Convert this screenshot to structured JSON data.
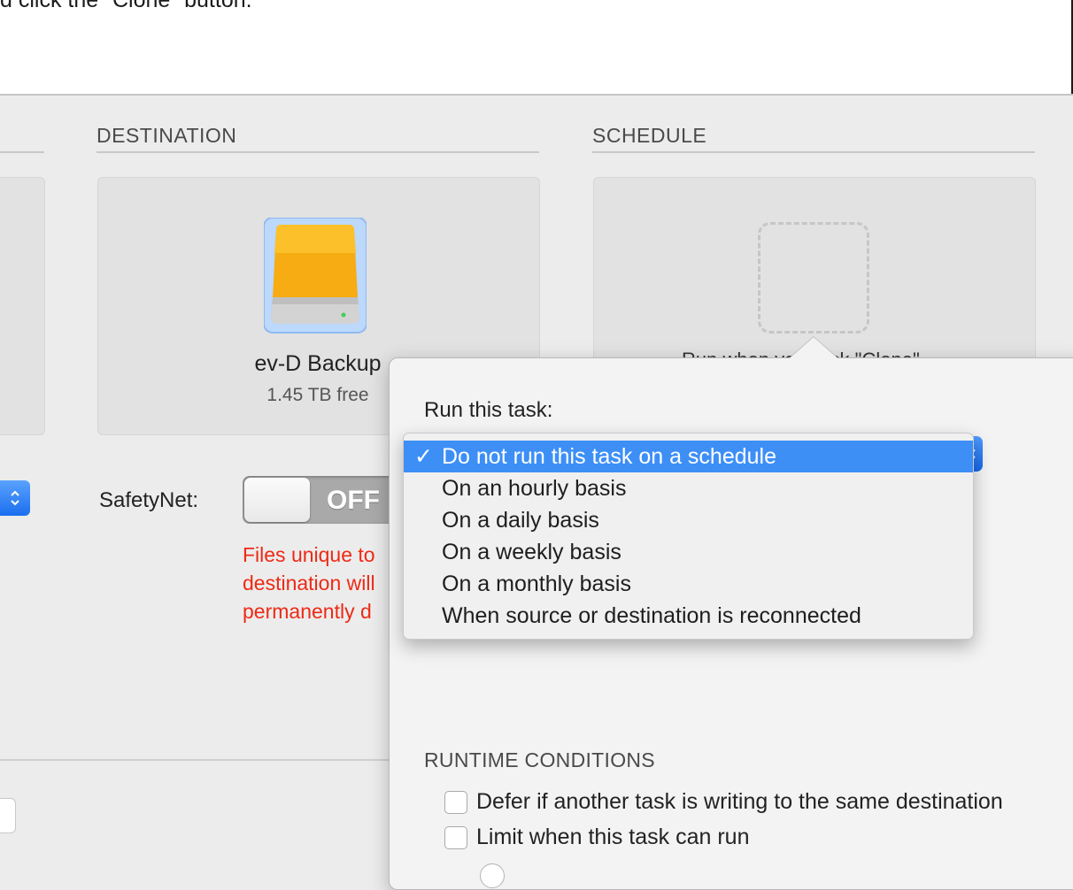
{
  "instruction_text": "d click the \"Clone\" button.",
  "destination": {
    "heading": "DESTINATION",
    "drive_name": "ev-D Backup",
    "drive_free": "1.45 TB free"
  },
  "schedule": {
    "heading": "SCHEDULE",
    "placeholder_text": "Run when you click \"Clone\""
  },
  "safetynet": {
    "label": "SafetyNet:",
    "toggle_state": "OFF",
    "warning_lines": [
      "Files unique to",
      "destination will",
      "permanently d"
    ]
  },
  "popover": {
    "run_label": "Run this task:",
    "options": [
      "Do not run this task on a schedule",
      "On an hourly basis",
      "On a daily basis",
      "On a weekly basis",
      "On a monthly basis",
      "When source or destination is reconnected"
    ],
    "selected_index": 0,
    "check_glyph": "✓",
    "runtime_heading": "RUNTIME CONDITIONS",
    "checkboxes": [
      {
        "label": "Defer if another task is writing to the same destination",
        "checked": false
      },
      {
        "label": "Limit when this task can run",
        "checked": false
      }
    ]
  },
  "colors": {
    "accent": "#3d8ff6",
    "warning": "#ee2a15",
    "drive_orange": "#f6ac12"
  }
}
